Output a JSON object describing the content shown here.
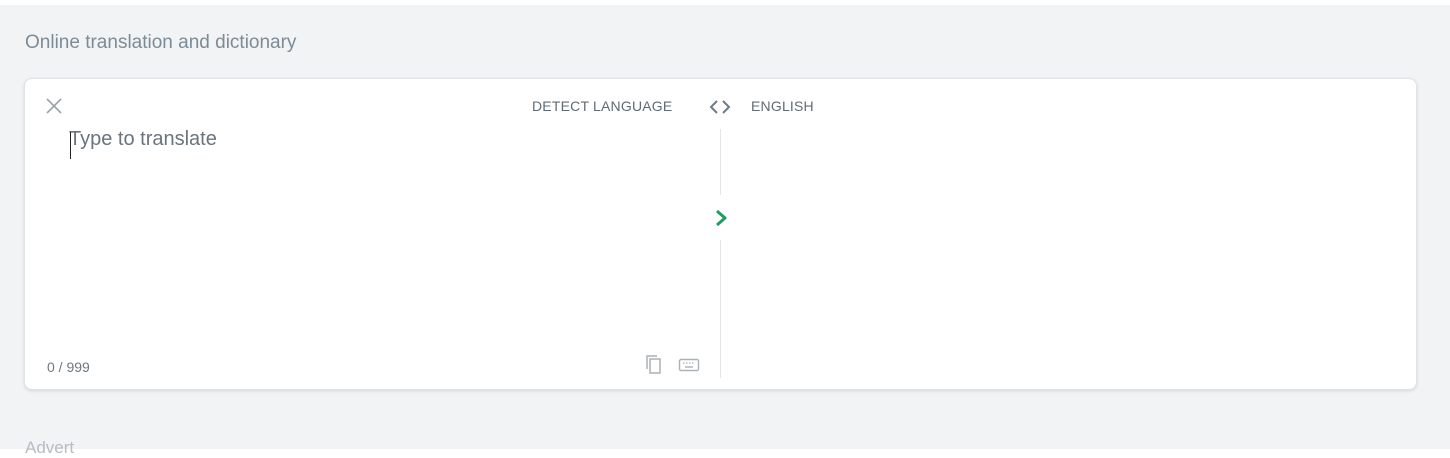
{
  "page": {
    "title": "Online translation and dictionary",
    "advert_label": "Advert"
  },
  "translator": {
    "source_language": "DETECT LANGUAGE",
    "target_language": "ENGLISH",
    "input": {
      "value": "",
      "placeholder": "Type to translate"
    },
    "char_count": "0 / 999",
    "icons": {
      "clear": "close-icon",
      "swap": "swap-languages-icon",
      "translate": "chevron-right-icon",
      "copy": "copy-icon",
      "keyboard": "keyboard-icon"
    }
  },
  "colors": {
    "background": "#f2f3f5",
    "accent": "#1e9e5e",
    "muted_text": "#5f6b74"
  }
}
